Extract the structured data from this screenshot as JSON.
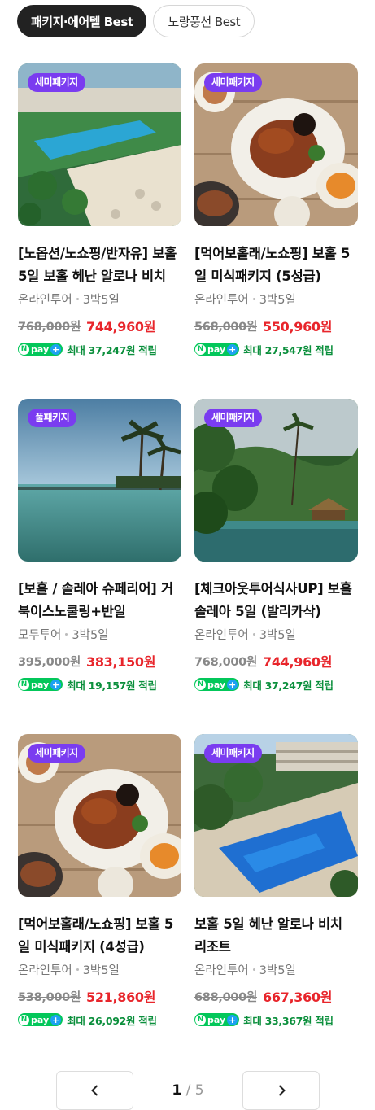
{
  "tabs": [
    {
      "label": "패키지·에어텔 Best",
      "active": true
    },
    {
      "label": "노랑풍선 Best",
      "active": false
    }
  ],
  "products": [
    {
      "badge": "세미패키지",
      "title": "[노옵션/노쇼핑/반자유] 보홀 5일 보홀 헤난 알로나 비치",
      "vendor": "온라인투어",
      "duration": "3박5일",
      "original_price": "768,000원",
      "sale_price": "744,960원",
      "points": "최대 37,247원 적립",
      "image": "resort-aerial"
    },
    {
      "badge": "세미패키지",
      "title": "[먹어보홀래/노쇼핑] 보홀 5일 미식패키지 (5성급)",
      "vendor": "온라인투어",
      "duration": "3박5일",
      "original_price": "568,000원",
      "sale_price": "550,960원",
      "points": "최대 27,547원 적립",
      "image": "food-table"
    },
    {
      "badge": "풀패키지",
      "title": "[보홀 / 솔레아 슈페리어] 거북이스노쿨링+반일",
      "vendor": "모두투어",
      "duration": "3박5일",
      "original_price": "395,000원",
      "sale_price": "383,150원",
      "points": "최대 19,157원 적립",
      "image": "infinity-pool"
    },
    {
      "badge": "세미패키지",
      "title": "[체크아웃투어식사UP] 보홀 솔레아 5일 (발리카삭)",
      "vendor": "온라인투어",
      "duration": "3박5일",
      "original_price": "768,000원",
      "sale_price": "744,960원",
      "points": "최대 37,247원 적립",
      "image": "river-jungle"
    },
    {
      "badge": "세미패키지",
      "title": "[먹어보홀래/노쇼핑] 보홀 5일 미식패키지 (4성급)",
      "vendor": "온라인투어",
      "duration": "3박5일",
      "original_price": "538,000원",
      "sale_price": "521,860원",
      "points": "최대 26,092원 적립",
      "image": "food-table"
    },
    {
      "badge": "세미패키지",
      "title": "보홀 5일 헤난 알로나 비치 리조트",
      "vendor": "온라인투어",
      "duration": "3박5일",
      "original_price": "688,000원",
      "sale_price": "667,360원",
      "points": "최대 33,367원 적립",
      "image": "resort-pool"
    }
  ],
  "npay": {
    "label": "pay",
    "n_label": "N",
    "plus_label": "+"
  },
  "pagination": {
    "current": "1",
    "separator": "/",
    "total": "5",
    "prev_icon": "chevron-left-icon",
    "next_icon": "chevron-right-icon"
  },
  "colors": {
    "badge": "#7a3cf0",
    "sale": "#e8252b",
    "npay": "#03c75a",
    "points": "#0b8f3c"
  }
}
